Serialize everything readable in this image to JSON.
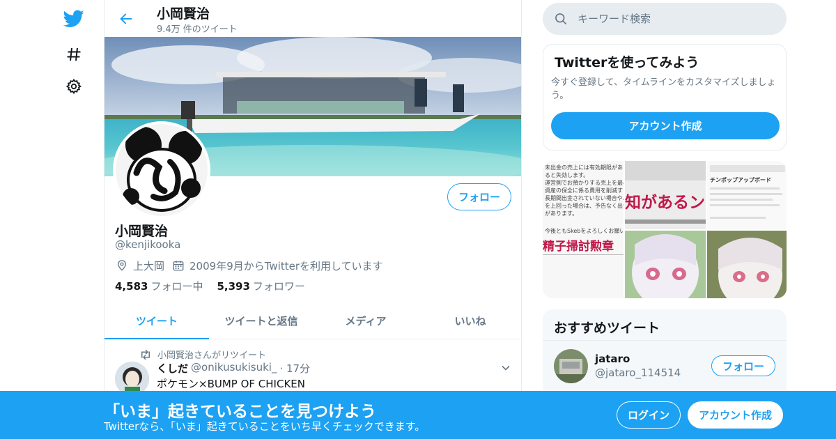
{
  "colors": {
    "accent": "#1da1f2",
    "secondary_text": "#657786",
    "border": "#e6ecf0"
  },
  "nav": {
    "icons": [
      "twitter-logo-icon",
      "hashtag-icon",
      "gear-icon"
    ]
  },
  "header": {
    "name": "小岡賢治",
    "tweet_count": "9.4万 件のツイート"
  },
  "profile": {
    "name": "小岡賢治",
    "handle": "@kenjikooka",
    "location": "上大岡",
    "joined": "2009年9月からTwitterを利用しています",
    "following_count": "4,583",
    "following_label": "フォロー中",
    "followers_count": "5,393",
    "followers_label": "フォロワー",
    "follow_button": "フォロー"
  },
  "tabs": [
    {
      "label": "ツイート",
      "active": true
    },
    {
      "label": "ツイートと返信",
      "active": false
    },
    {
      "label": "メディア",
      "active": false
    },
    {
      "label": "いいね",
      "active": false
    }
  ],
  "tweet": {
    "retweet_note": "小岡賢治さんがリツイート",
    "author": "くしだ",
    "handle": "@onikusukisuki_",
    "time": "· 17分",
    "text": "ポケモン×BUMP OF CHICKEN"
  },
  "search": {
    "placeholder": "キーワード検索"
  },
  "signup_card": {
    "title": "Twitterを使ってみよう",
    "body": "今すぐ登録して、タイムラインをカスタマイズしましょう。",
    "button": "アカウント作成"
  },
  "media_grid": {
    "cell1_lines": [
      "未出金の売上には有効期限があり、",
      "ると失効します。",
      "運営側でお預かりする売上を最小",
      "資産の保全に係る費用を削減する",
      "長期間出金されていない場合や、",
      "を上回った場合は、予告なく出金",
      "があります。",
      "今後ともSkebをよろしくお願い"
    ],
    "cell1_bottom": "精子掃討勲章",
    "cell2_text": "知があるン",
    "cell3_title": "チンポップアップボード"
  },
  "recommend": {
    "title": "おすすめツイート",
    "user_name": "jataro",
    "user_handle": "@jataro_114514",
    "follow_button": "フォロー"
  },
  "bottombar": {
    "title": "「いま」起きていることを見つけよう",
    "subtitle": "Twitterなら、「いま」起きていることをいち早くチェックできます。",
    "login": "ログイン",
    "signup": "アカウント作成"
  }
}
